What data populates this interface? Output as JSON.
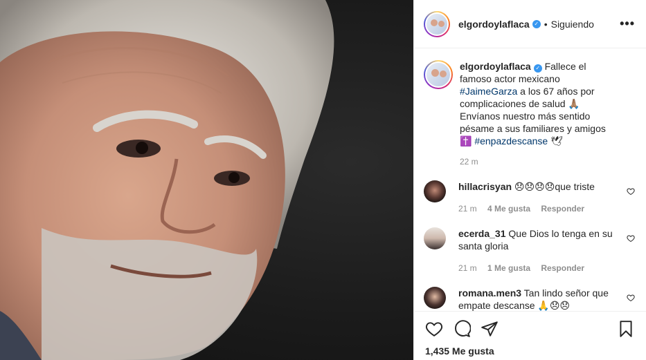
{
  "post": {
    "username": "elgordoylaflaca",
    "verified_icon": "verified-check-icon",
    "dot": "•",
    "follow_status": "Siguiendo",
    "more_icon": "•••",
    "accent_color": "#3897f0"
  },
  "caption": {
    "username": "elgordoylaflaca",
    "text_before": " Fallece el famoso actor mexicano ",
    "hashtag1": "#JaimeGarza",
    "text_middle": " a los 67 años por complicaciones de salud 🙏🏽 Envíanos nuestro más sentido pésame a sus familiares y amigos ✝️ ",
    "hashtag2": "#enpazdescanse",
    "emoji_tail": " 🕊",
    "time": "22 m"
  },
  "comments": [
    {
      "username": "hillacrisyan",
      "text": " 😞😞😞😞que triste",
      "time": "21 m",
      "likes": "4 Me gusta",
      "reply": "Responder"
    },
    {
      "username": "ecerda_31",
      "text": " Que Dios lo tenga en su santa gloria",
      "time": "21 m",
      "likes": "1 Me gusta",
      "reply": "Responder"
    },
    {
      "username": "romana.men3",
      "text": " Tan lindo señor que empate descanse 🙏😞😞",
      "time": "",
      "likes": "",
      "reply": ""
    }
  ],
  "footer": {
    "likes": "1,435 Me gusta"
  }
}
